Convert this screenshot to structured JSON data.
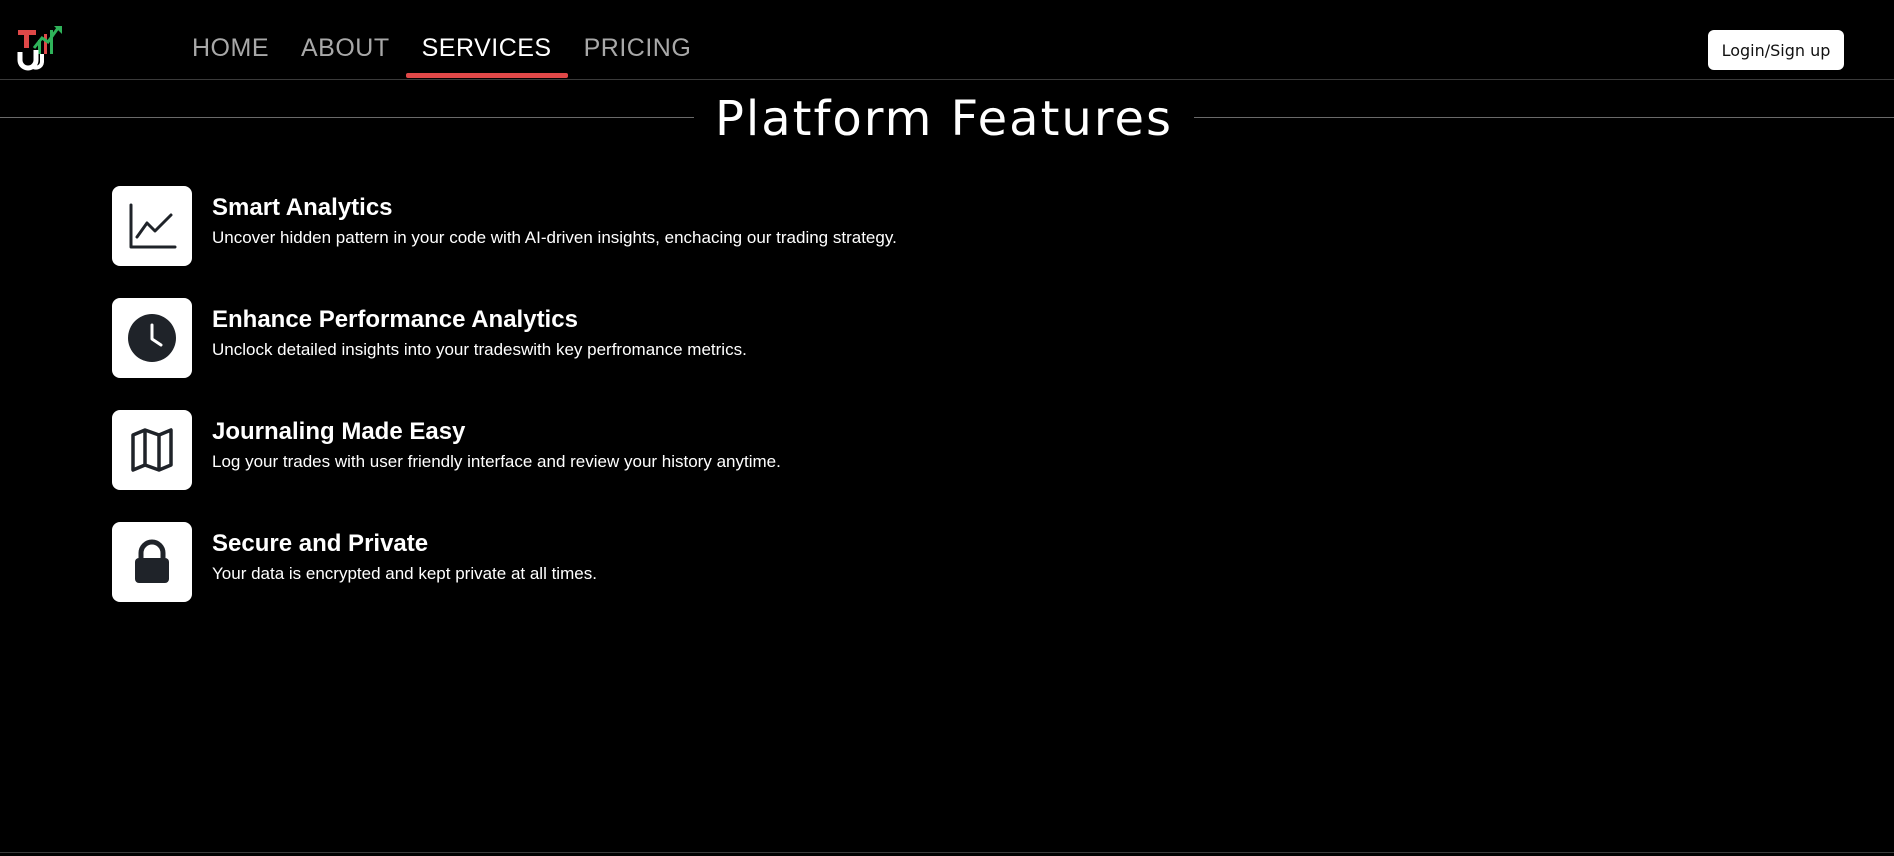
{
  "header": {
    "logo_text": "TJ",
    "nav": [
      {
        "label": "HOME",
        "active": false
      },
      {
        "label": "ABOUT",
        "active": false
      },
      {
        "label": "SERVICES",
        "active": true
      },
      {
        "label": "PRICING",
        "active": false
      }
    ],
    "login_label": "Login/Sign up"
  },
  "section": {
    "title": "Platform Features"
  },
  "features": [
    {
      "icon": "line-chart-icon",
      "title": "Smart Analytics",
      "description": "Uncover hidden pattern in your code with AI-driven insights, enchacing our trading strategy."
    },
    {
      "icon": "clock-icon",
      "title": "Enhance Performance Analytics",
      "description": "Unclock detailed insights into your tradeswith key perfromance metrics."
    },
    {
      "icon": "map-icon",
      "title": "Journaling Made Easy",
      "description": "Log your trades with user friendly interface and review your history anytime."
    },
    {
      "icon": "lock-icon",
      "title": "Secure and Private",
      "description": "Your data is encrypted and kept private at all times."
    }
  ],
  "colors": {
    "background": "#000000",
    "accent": "#e04848",
    "logo_green": "#2fb35a",
    "logo_red": "#e04848",
    "nav_inactive": "#a8a8a8",
    "icon_dark": "#1f2329"
  }
}
